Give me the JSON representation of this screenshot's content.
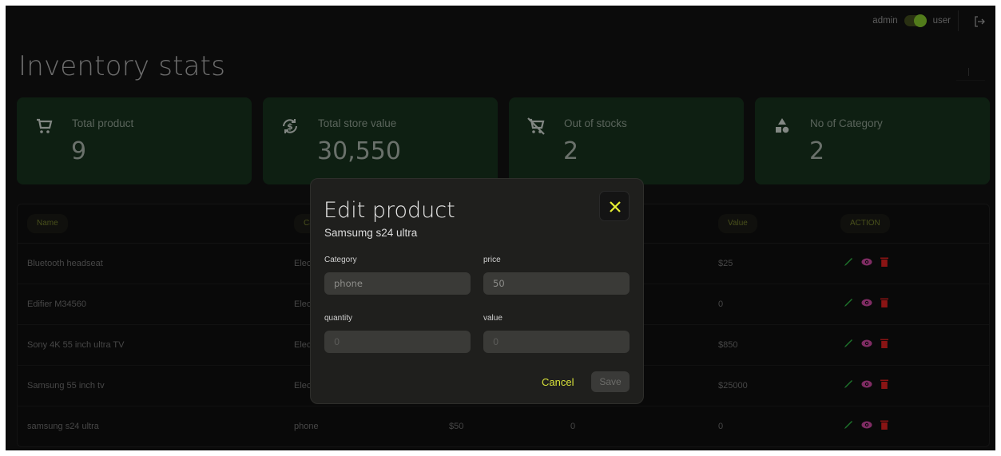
{
  "header": {
    "role_left": "admin",
    "role_right": "user",
    "page_title": "Inventory stats"
  },
  "stats": [
    {
      "icon": "cart-icon",
      "label": "Total product",
      "value": "9"
    },
    {
      "icon": "currency-exchange-icon",
      "label": "Total store value",
      "value": "30,550"
    },
    {
      "icon": "remove-cart-icon",
      "label": "Out of stocks",
      "value": "2"
    },
    {
      "icon": "category-shapes-icon",
      "label": "No of Category",
      "value": "2"
    }
  ],
  "table": {
    "columns": [
      "Name",
      "Ca",
      "Value",
      "ACTION"
    ],
    "rows": [
      {
        "name": "Bluetooth headseat",
        "category": "Elec",
        "price": "",
        "quantity": "",
        "value": "$25"
      },
      {
        "name": "Edifier M34560",
        "category": "Elec",
        "price": "",
        "quantity": "",
        "value": "0"
      },
      {
        "name": "Sony 4K 55 inch ultra TV",
        "category": "Elec",
        "price": "",
        "quantity": "",
        "value": "$850"
      },
      {
        "name": "Samsung 55 inch tv",
        "category": "Elec",
        "price": "",
        "quantity": "",
        "value": "$25000"
      },
      {
        "name": "samsung s24 ultra",
        "category": "phone",
        "price": "$50",
        "quantity": "0",
        "value": "0"
      }
    ]
  },
  "modal": {
    "title": "Edit product",
    "subtitle": "Samsumg s24 ultra",
    "fields": {
      "category": {
        "label": "Category",
        "value": "phone"
      },
      "price": {
        "label": "price",
        "value": "50"
      },
      "quantity": {
        "label": "quantity",
        "value": "0"
      },
      "value": {
        "label": "value",
        "value": "0"
      }
    },
    "cancel_label": "Cancel",
    "save_label": "Save"
  },
  "colors": {
    "accent": "#d8e23a",
    "card_bg": "#16301d",
    "edit_icon": "#2fb344",
    "view_icon": "#c5449a",
    "delete_icon": "#d42020"
  }
}
